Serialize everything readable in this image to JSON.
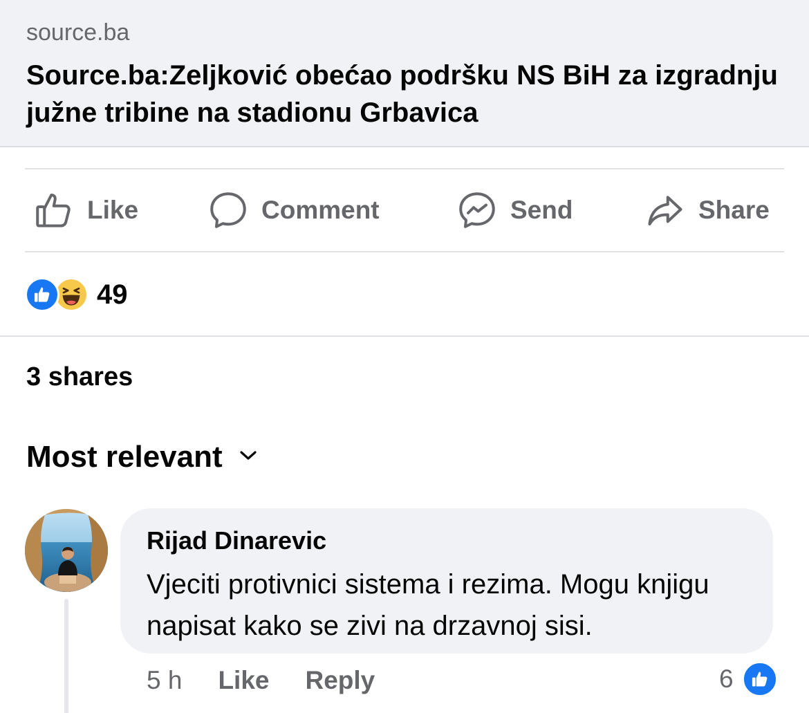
{
  "link_preview": {
    "domain": "source.ba",
    "title": "Source.ba:Zeljković obećao podršku NS BiH za izgradnju južne tribine na stadionu Grbavica"
  },
  "actions": {
    "like": "Like",
    "comment": "Comment",
    "send": "Send",
    "share": "Share"
  },
  "reactions": {
    "types": [
      "like-icon",
      "haha-icon"
    ],
    "count": "49"
  },
  "shares_text": "3 shares",
  "sort": {
    "label": "Most relevant"
  },
  "comment": {
    "author": "Rijad Dinarevic",
    "text": "Vjeciti protivnici sistema i rezima. Mogu knjigu napisat kako se zivi na drzavnoj sisi.",
    "time": "5 h",
    "like_label": "Like",
    "reply_label": "Reply",
    "reaction_count": "6"
  },
  "colors": {
    "accent": "#1877f2",
    "secondary_text": "#65676b",
    "preview_bg": "#f0f2f5",
    "haha_yellow": "#f7c94a"
  }
}
